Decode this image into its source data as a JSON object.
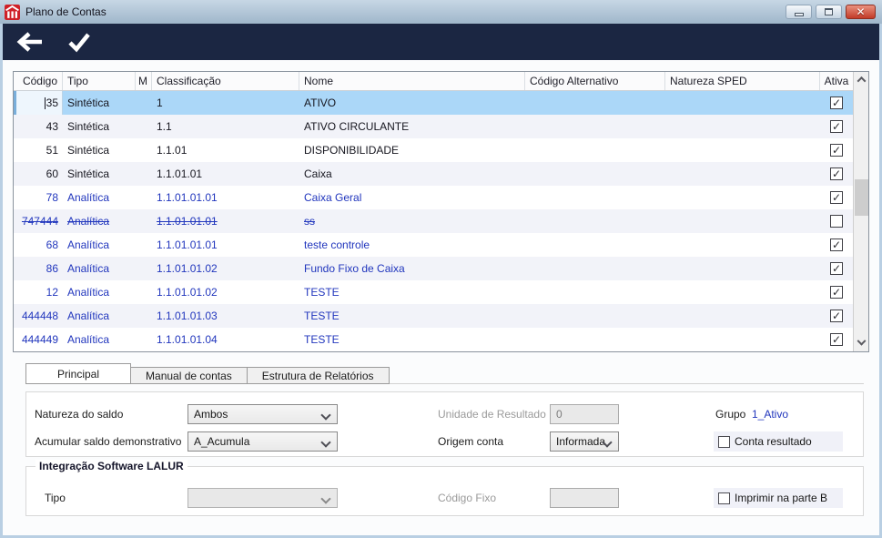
{
  "window": {
    "title": "Plano de Contas"
  },
  "titlebar": {
    "icons": {
      "app": "app-logo",
      "minimize": "minimize",
      "maximize": "maximize",
      "close": "close"
    },
    "close_glyph": "✕"
  },
  "toolbar": {
    "icons": [
      "back-arrow",
      "confirm-check"
    ]
  },
  "grid": {
    "columns": {
      "codigo": "Código",
      "tipo": "Tipo",
      "m": "M",
      "classificacao": "Classificação",
      "nome": "Nome",
      "codigo_alternativo": "Código Alternativo",
      "natureza_sped": "Natureza SPED",
      "ativa": "Ativa"
    },
    "rows": [
      {
        "codigo": "35",
        "tipo": "Sintética",
        "m": "",
        "classificacao": "1",
        "nome": "ATIVO",
        "codigo_alternativo": "",
        "natureza_sped": "",
        "ativa": true,
        "kind": "sintetica",
        "selected": true,
        "editing": true,
        "strike": false
      },
      {
        "codigo": "43",
        "tipo": "Sintética",
        "m": "",
        "classificacao": "1.1",
        "nome": "ATIVO CIRCULANTE",
        "codigo_alternativo": "",
        "natureza_sped": "",
        "ativa": true,
        "kind": "sintetica",
        "selected": false,
        "editing": false,
        "strike": false
      },
      {
        "codigo": "51",
        "tipo": "Sintética",
        "m": "",
        "classificacao": "1.1.01",
        "nome": "DISPONIBILIDADE",
        "codigo_alternativo": "",
        "natureza_sped": "",
        "ativa": true,
        "kind": "sintetica",
        "selected": false,
        "editing": false,
        "strike": false
      },
      {
        "codigo": "60",
        "tipo": "Sintética",
        "m": "",
        "classificacao": "1.1.01.01",
        "nome": "Caixa",
        "codigo_alternativo": "",
        "natureza_sped": "",
        "ativa": true,
        "kind": "sintetica",
        "selected": false,
        "editing": false,
        "strike": false
      },
      {
        "codigo": "78",
        "tipo": "Analítica",
        "m": "",
        "classificacao": "1.1.01.01.01",
        "nome": "Caixa Geral",
        "codigo_alternativo": "",
        "natureza_sped": "",
        "ativa": true,
        "kind": "analitica",
        "selected": false,
        "editing": false,
        "strike": false
      },
      {
        "codigo": "747444",
        "tipo": "Analítica",
        "m": "",
        "classificacao": "1.1.01.01.01",
        "nome": "ss",
        "codigo_alternativo": "",
        "natureza_sped": "",
        "ativa": false,
        "kind": "analitica",
        "selected": false,
        "editing": false,
        "strike": true
      },
      {
        "codigo": "68",
        "tipo": "Analítica",
        "m": "",
        "classificacao": "1.1.01.01.01",
        "nome": "teste controle",
        "codigo_alternativo": "",
        "natureza_sped": "",
        "ativa": true,
        "kind": "analitica",
        "selected": false,
        "editing": false,
        "strike": false
      },
      {
        "codigo": "86",
        "tipo": "Analítica",
        "m": "",
        "classificacao": "1.1.01.01.02",
        "nome": "Fundo Fixo de Caixa",
        "codigo_alternativo": "",
        "natureza_sped": "",
        "ativa": true,
        "kind": "analitica",
        "selected": false,
        "editing": false,
        "strike": false
      },
      {
        "codigo": "12",
        "tipo": "Analítica",
        "m": "",
        "classificacao": "1.1.01.01.02",
        "nome": "TESTE",
        "codigo_alternativo": "",
        "natureza_sped": "",
        "ativa": true,
        "kind": "analitica",
        "selected": false,
        "editing": false,
        "strike": false
      },
      {
        "codigo": "444448",
        "tipo": "Analítica",
        "m": "",
        "classificacao": "1.1.01.01.03",
        "nome": "TESTE",
        "codigo_alternativo": "",
        "natureza_sped": "",
        "ativa": true,
        "kind": "analitica",
        "selected": false,
        "editing": false,
        "strike": false
      },
      {
        "codigo": "444449",
        "tipo": "Analítica",
        "m": "",
        "classificacao": "1.1.01.01.04",
        "nome": "TESTE",
        "codigo_alternativo": "",
        "natureza_sped": "",
        "ativa": true,
        "kind": "analitica",
        "selected": false,
        "editing": false,
        "strike": false
      }
    ]
  },
  "tabs": [
    {
      "label": "Principal",
      "active": true
    },
    {
      "label": "Manual de contas",
      "active": false
    },
    {
      "label": "Estrutura de Relatórios",
      "active": false
    }
  ],
  "form": {
    "natureza_do_saldo": {
      "label": "Natureza do saldo",
      "value": "Ambos"
    },
    "acumular_saldo": {
      "label": "Acumular saldo demonstrativo",
      "value": "A_Acumula"
    },
    "unidade_de_resultado": {
      "label": "Unidade de Resultado",
      "value": "0"
    },
    "origem_conta": {
      "label": "Origem conta",
      "value": "Informada"
    },
    "grupo": {
      "label": "Grupo",
      "value": "1_Ativo"
    },
    "conta_resultado": {
      "label": "Conta resultado",
      "checked": false
    }
  },
  "lalur": {
    "title": "Integração Software LALUR",
    "tipo": {
      "label": "Tipo",
      "value": ""
    },
    "codigo_fixo": {
      "label": "Código Fixo",
      "value": ""
    },
    "imprimir_parte_b": {
      "label": "Imprimir na parte B",
      "checked": false
    }
  },
  "colors": {
    "toolbar": "#1b2642",
    "selected_row": "#abd7f8",
    "analitica_text": "#2136bd",
    "row_stripe": "#f2f3f9",
    "close_button": "#c23b28",
    "app_icon": "#cf2027"
  }
}
